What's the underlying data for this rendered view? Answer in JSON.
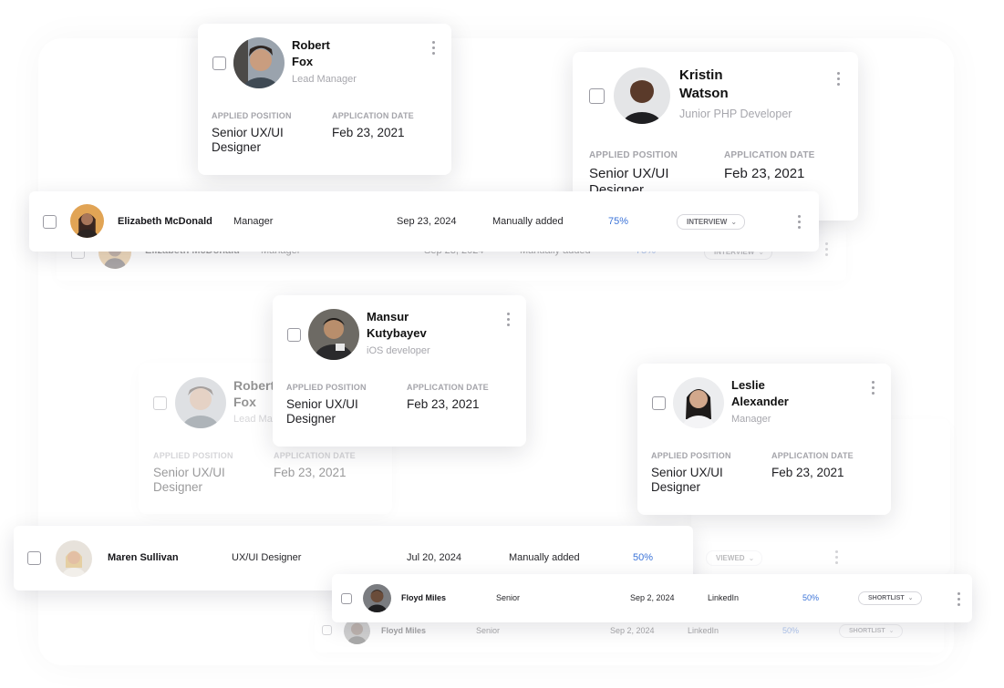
{
  "labels": {
    "applied_position": "APPLIED POSITION",
    "application_date": "APPLICATION DATE"
  },
  "cards": {
    "robert_top": {
      "name1": "Robert",
      "name2": "Fox",
      "role": "Lead Manager",
      "position1": "Senior UX/UI",
      "position2": "Designer",
      "date": "Feb 23, 2021"
    },
    "kristin": {
      "name1": "Kristin",
      "name2": "Watson",
      "role": "Junior PHP Developer",
      "position1": "Senior UX/UI",
      "position2": "Designer",
      "date": "Feb 23, 2021"
    },
    "mansur": {
      "name1": "Mansur",
      "name2": "Kutybayev",
      "role": "iOS developer",
      "position1": "Senior UX/UI",
      "position2": "Designer",
      "date": "Feb 23, 2021"
    },
    "robert_faded": {
      "name1": "Robert",
      "name2": "Fox",
      "role": "Lead Manager",
      "position1": "Senior UX/UI",
      "position2": "Designer",
      "date": "Feb 23, 2021"
    },
    "leslie": {
      "name1": "Leslie",
      "name2": "Alexander",
      "role": "Manager",
      "position1": "Senior UX/UI",
      "position2": "Designer",
      "date": "Feb 23, 2021"
    }
  },
  "rows": {
    "elizabeth": {
      "name": "Elizabeth McDonald",
      "role": "Manager",
      "date": "Sep 23, 2024",
      "source": "Manually added",
      "score": "75%",
      "status": "INTERVIEW"
    },
    "maren": {
      "name": "Maren Sullivan",
      "role": "UX/UI Designer",
      "date": "Jul 20, 2024",
      "source": "Manually added",
      "score": "50%",
      "status": "VIEWED"
    },
    "floyd": {
      "name": "Floyd Miles",
      "role": "Senior",
      "date": "Sep 2, 2024",
      "source": "LinkedIn",
      "score": "50%",
      "status": "SHORTLIST"
    }
  },
  "colors": {
    "accent": "#3c74d8"
  }
}
